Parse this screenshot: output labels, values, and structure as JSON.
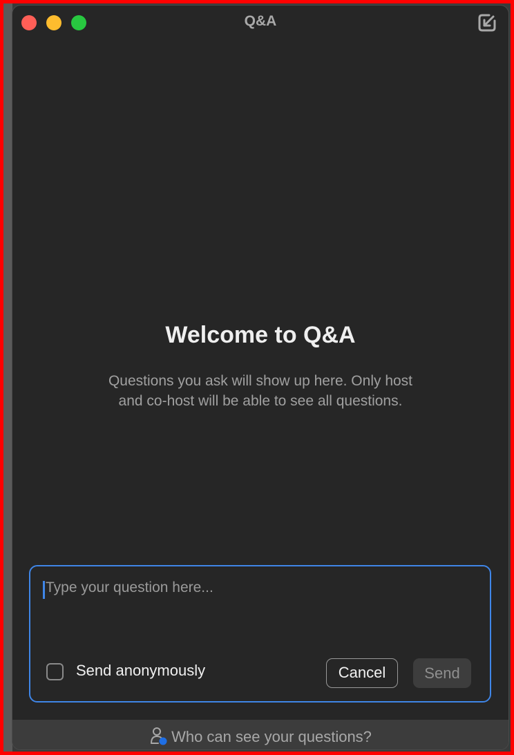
{
  "window": {
    "title": "Q&A"
  },
  "icons": {
    "popout": "popout-arrow-icon",
    "footer": "person-visibility-icon"
  },
  "empty_state": {
    "heading": "Welcome to Q&A",
    "description": "Questions you ask will show up here. Only host and co-host will be able to see all questions."
  },
  "composer": {
    "placeholder": "Type your question here...",
    "value": "",
    "anonymous_label": "Send anonymously",
    "anonymous_checked": false,
    "cancel_label": "Cancel",
    "send_label": "Send"
  },
  "footer": {
    "label": "Who can see your questions?"
  },
  "colors": {
    "accent": "#3f86e8",
    "window_bg": "#262626",
    "close": "#ff5f57",
    "minimize": "#febc2e",
    "zoom": "#28c840"
  }
}
